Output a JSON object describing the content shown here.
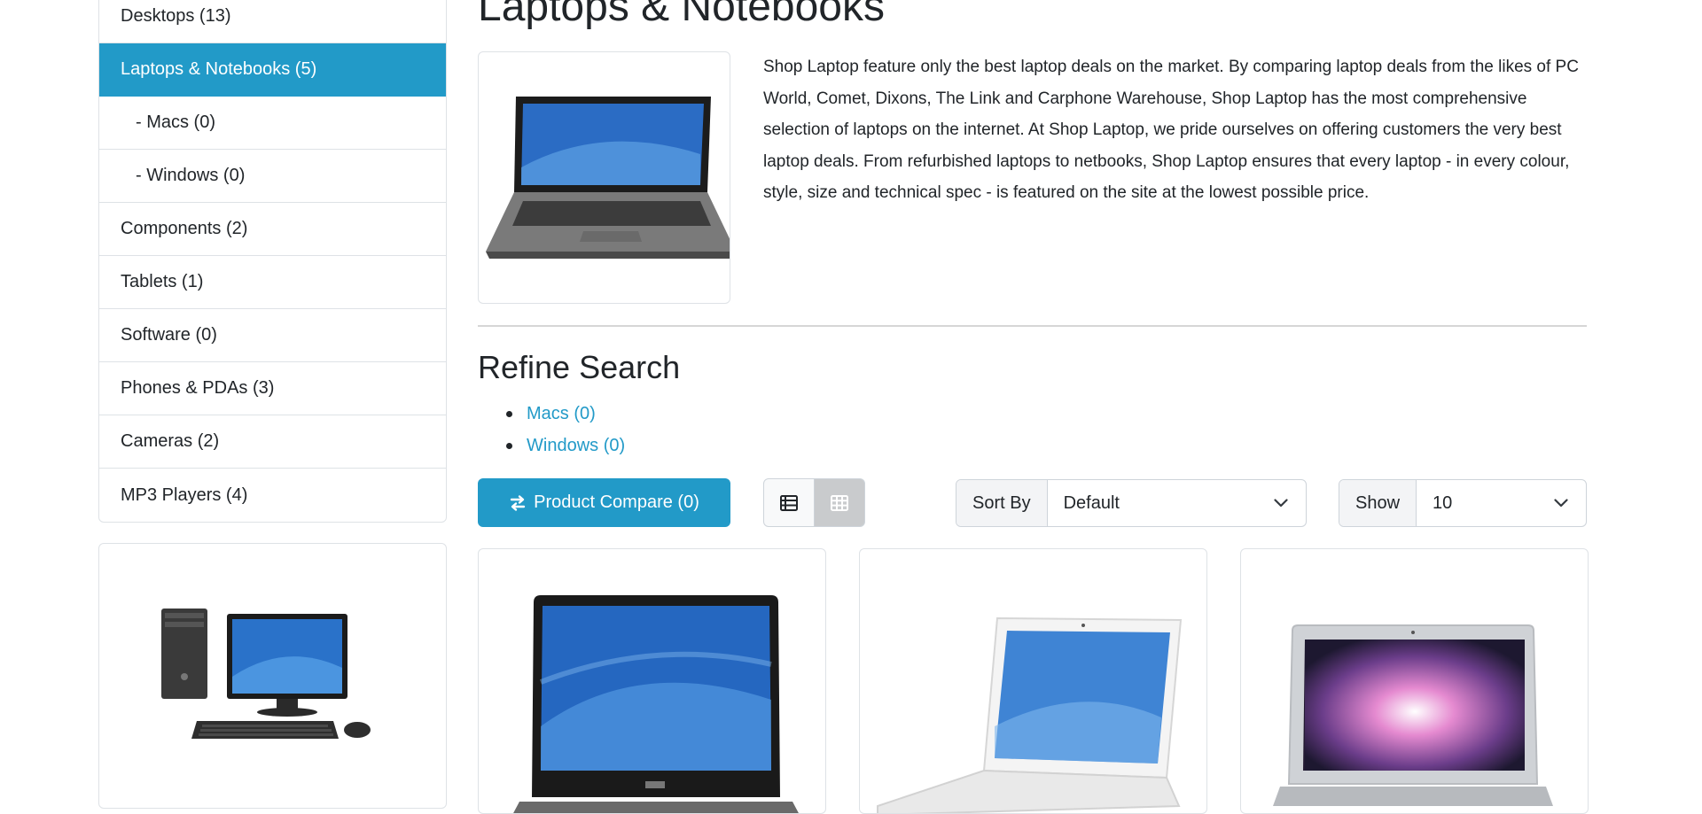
{
  "sidebar": {
    "categories": [
      {
        "label": "Desktops (13)"
      },
      {
        "label": "Laptops & Notebooks (5)"
      },
      {
        "label": "- Macs (0)"
      },
      {
        "label": "- Windows (0)"
      },
      {
        "label": "Components (2)"
      },
      {
        "label": "Tablets (1)"
      },
      {
        "label": "Software (0)"
      },
      {
        "label": "Phones & PDAs (3)"
      },
      {
        "label": "Cameras (2)"
      },
      {
        "label": "MP3 Players (4)"
      }
    ],
    "active_index": 1
  },
  "category": {
    "title": "Laptops & Notebooks",
    "description": "Shop Laptop feature only the best laptop deals on the market. By comparing laptop deals from the likes of PC World, Comet, Dixons, The Link and Carphone Warehouse, Shop Laptop has the most comprehensive selection of laptops on the internet. At Shop Laptop, we pride ourselves on offering customers the very best laptop deals. From refurbished laptops to netbooks, Shop Laptop ensures that every laptop - in every colour, style, size and technical spec - is featured on the site at the lowest possible price."
  },
  "refine": {
    "title": "Refine Search",
    "links": [
      {
        "label": "Macs (0)"
      },
      {
        "label": "Windows (0)"
      }
    ]
  },
  "toolbar": {
    "compare_label": "Product Compare (0)",
    "sort_label": "Sort By",
    "sort_value": "Default",
    "show_label": "Show",
    "show_value": "10"
  },
  "colors": {
    "accent": "#229ac8",
    "border": "#dee2e6"
  },
  "icons": {
    "compare": "arrows-exchange-icon",
    "list_view": "list-view-icon",
    "grid_view": "grid-view-icon",
    "dropdown": "chevron-down-icon"
  }
}
